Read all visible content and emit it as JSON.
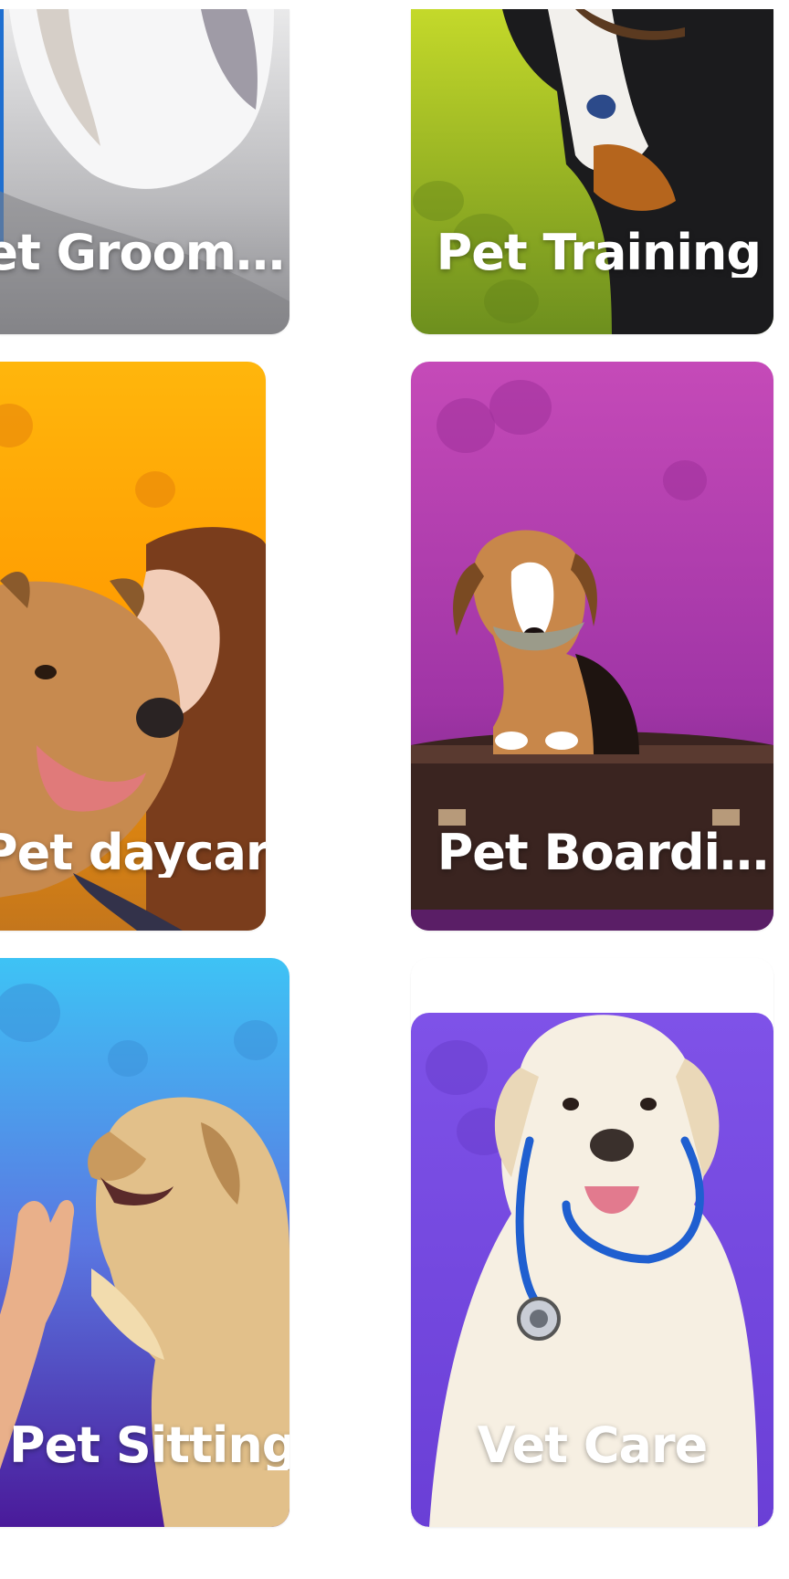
{
  "services": {
    "grooming": {
      "label": "et Groom…",
      "icon": "grooming-dog-photo"
    },
    "training": {
      "label": "Pet Training",
      "icon": "training-dog-photo"
    },
    "daycare": {
      "label": "Pet daycare",
      "icon": "daycare-dog-photo"
    },
    "boarding": {
      "label": "Pet Boardi…",
      "icon": "boarding-beagle-photo"
    },
    "sitting": {
      "label": "Pet Sitting",
      "icon": "sitting-high-five-photo"
    },
    "vet": {
      "label": "Vet Care",
      "icon": "vet-labrador-photo"
    }
  },
  "colors": {
    "training_bg": "#a6c72a",
    "daycare_bg": "#ffa400",
    "boarding_bg": "#b23fb0",
    "sitting_bg": "#4f7fe6",
    "vet_bg": "#7b4fe6",
    "label_text": "#ffffff"
  }
}
